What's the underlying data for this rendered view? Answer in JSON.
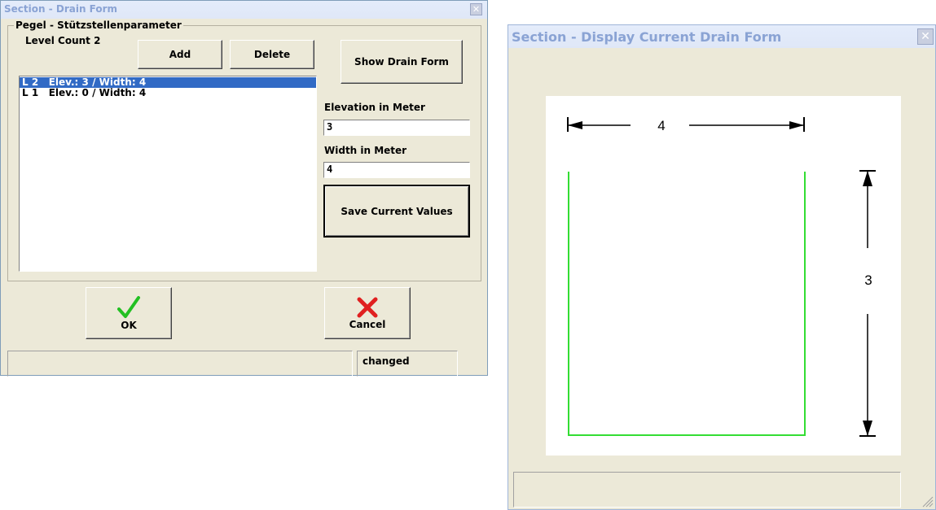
{
  "drain_form": {
    "title": "Section - Drain Form",
    "group_title": "Pegel - Stützstellenparameter",
    "level_count_label": "Level Count 2",
    "add_label": "Add",
    "delete_label": "Delete",
    "show_drain_form_label": "Show Drain Form",
    "levels": [
      "L 2   Elev.: 3 / Width: 4",
      "L 1   Elev.: 0 / Width: 4"
    ],
    "elevation_label": "Elevation in Meter",
    "elevation_value": "3",
    "width_label": "Width in Meter",
    "width_value": "4",
    "save_label": "Save Current Values",
    "ok_label": "OK",
    "cancel_label": "Cancel",
    "status_text": "",
    "status_changed": "changed"
  },
  "display_form": {
    "title": "Section - Display Current Drain Form",
    "width_dimension": "4",
    "height_dimension": "3",
    "status_text": "",
    "profile_color": "#33dd33"
  },
  "colors": {
    "selection": "#316ac5",
    "window_bg": "#ece9d8",
    "ok_check": "#22c022",
    "cancel_x": "#e02020"
  },
  "icons": {
    "ok": "green-checkmark",
    "cancel": "red-x",
    "close": "close-x",
    "resize": "resize-grip"
  }
}
